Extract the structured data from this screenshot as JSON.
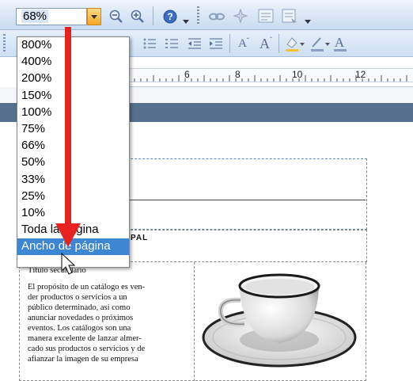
{
  "toolbar": {
    "zoom_value": "68%",
    "icons": [
      "zoom-out-icon",
      "zoom-in-icon",
      "help-icon",
      "hyperlink-icon",
      "clear-icon",
      "text-box-icon",
      "link-text-icon"
    ]
  },
  "format_toolbar": {
    "icons": [
      "bullets-icon",
      "numbering-icon",
      "decrease-indent-icon",
      "increase-indent-icon",
      "shrink-font-icon",
      "grow-font-icon",
      "fill-color-icon",
      "line-color-icon",
      "font-color-icon"
    ]
  },
  "ruler": {
    "labels": [
      "6",
      "8",
      "10",
      "12"
    ]
  },
  "zoom_menu": {
    "items": [
      "800%",
      "400%",
      "200%",
      "150%",
      "100%",
      "75%",
      "66%",
      "50%",
      "33%",
      "25%",
      "10%",
      "Toda la pagina",
      "Ancho de página"
    ],
    "highlighted_index": 12
  },
  "document": {
    "title_fragment": "PAL",
    "subtitle": "Título secundario",
    "body_lines": [
      "El propósito de un catálogo es ven-",
      "der productos o servicios a un",
      "público determinado, así como",
      "anunciar novedades o próximos",
      "eventos. Los catálogos son una",
      "manera excelente de lanzar almer-",
      "cado sus productos o servicios y de",
      "afianzar la imagen de su empresa"
    ]
  },
  "colors": {
    "toolbar_bg": "#c9dbf1",
    "menu_highlight": "#3d86d4",
    "arrow": "#e8231f",
    "band": "#58708f"
  }
}
